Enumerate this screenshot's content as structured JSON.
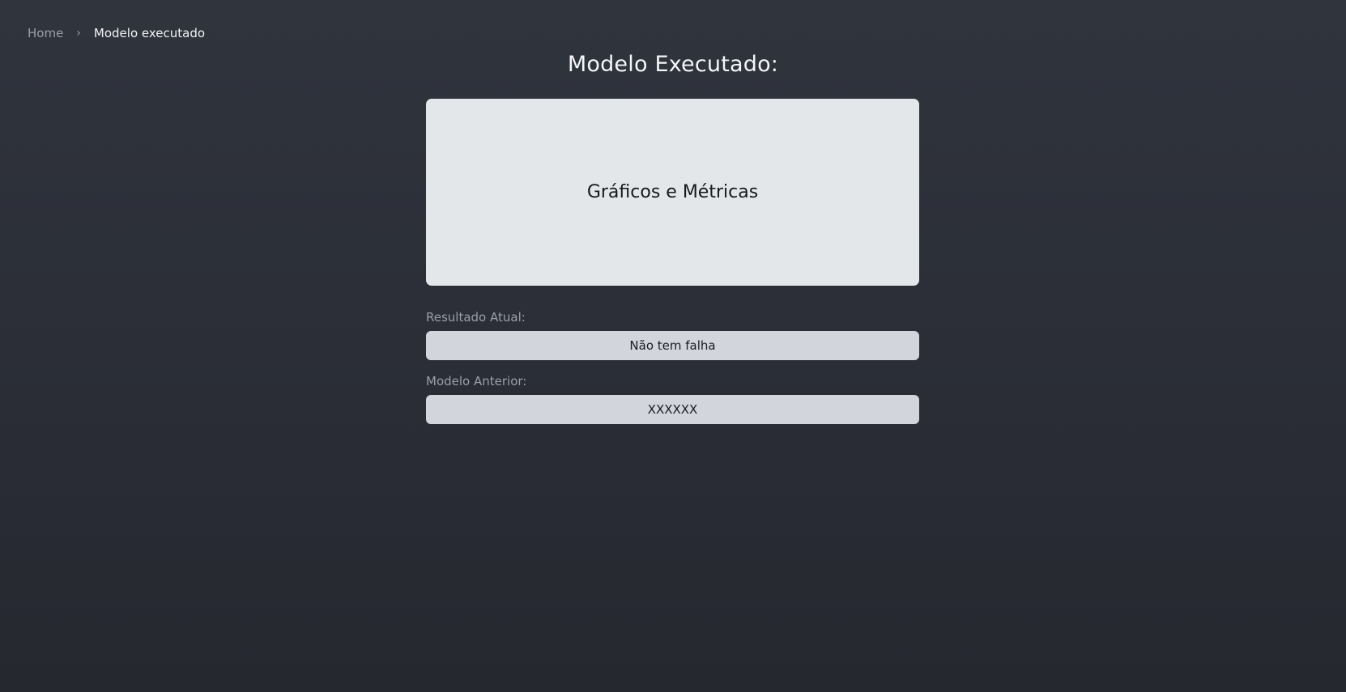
{
  "breadcrumb": {
    "home": "Home",
    "separator": "›",
    "current": "Modelo executado"
  },
  "page": {
    "title": "Modelo Executado:"
  },
  "metrics_card": {
    "label": "Gráficos e Métricas"
  },
  "resultado_atual": {
    "label": "Resultado Atual:",
    "value": "Não tem falha"
  },
  "modelo_anterior": {
    "label": "Modelo Anterior:",
    "value": "XXXXXX"
  },
  "colors": {
    "background": "#2b2e37",
    "card": "#e4e7ea",
    "field": "#d3d5dc",
    "muted_text": "#9b9fa8"
  }
}
